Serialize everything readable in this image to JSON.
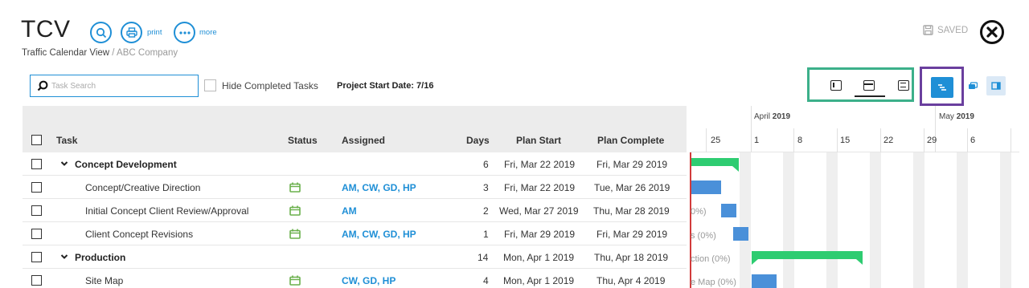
{
  "header": {
    "title": "TCV",
    "subtitle": "Traffic Calendar View",
    "company_sep": " / ABC Company",
    "print_label": "print",
    "more_label": "more",
    "saved_label": "SAVED"
  },
  "toolbar": {
    "search_placeholder": "Task Search",
    "hide_completed_label": "Hide Completed Tasks",
    "project_start": "Project Start Date: 7/16"
  },
  "columns": {
    "task": "Task",
    "status": "Status",
    "assigned": "Assigned",
    "days": "Days",
    "plan_start": "Plan Start",
    "plan_complete": "Plan Complete"
  },
  "rows": [
    {
      "name": "Concept Development",
      "group": true,
      "assigned": "",
      "days": "6",
      "start": "Fri, Mar 22 2019",
      "complete": "Fri, Mar 29 2019",
      "chart_label": ""
    },
    {
      "name": "Concept/Creative Direction",
      "group": false,
      "assigned": "AM, CW, GD, HP",
      "days": "3",
      "start": "Fri, Mar 22 2019",
      "complete": "Tue, Mar 26 2019",
      "chart_label": ""
    },
    {
      "name": "Initial Concept Client Review/Approval",
      "group": false,
      "assigned": "AM",
      "days": "2",
      "start": "Wed, Mar 27 2019",
      "complete": "Thu, Mar 28 2019",
      "chart_label": "0%)"
    },
    {
      "name": "Client Concept Revisions",
      "group": false,
      "assigned": "AM, CW, GD, HP",
      "days": "1",
      "start": "Fri, Mar 29 2019",
      "complete": "Fri, Mar 29 2019",
      "chart_label": "s (0%)"
    },
    {
      "name": "Production",
      "group": true,
      "assigned": "",
      "days": "14",
      "start": "Mon, Apr 1 2019",
      "complete": "Thu, Apr 18 2019",
      "chart_label": "ction (0%)"
    },
    {
      "name": "Site Map",
      "group": false,
      "assigned": "CW, GD, HP",
      "days": "4",
      "start": "Mon, Apr 1 2019",
      "complete": "Thu, Apr 4 2019",
      "chart_label": "e Map (0%)"
    }
  ],
  "gantt": {
    "months": [
      {
        "name": "April",
        "year": "2019"
      },
      {
        "name": "May",
        "year": "2019"
      }
    ],
    "days": [
      "25",
      "1",
      "8",
      "15",
      "22",
      "29",
      "6"
    ]
  },
  "colors": {
    "accent": "#1f8fd6",
    "task_bar": "#4a90d9",
    "summary_bar": "#2ecc71",
    "today_line": "#d23b3b",
    "status_icon": "#6ab04c"
  },
  "icons": {
    "search": "search-icon",
    "print": "print-icon",
    "more": "more-icon",
    "saved": "save-disk-icon",
    "close": "close-icon",
    "status": "calendar-icon",
    "expand": "chevron-down-icon"
  }
}
